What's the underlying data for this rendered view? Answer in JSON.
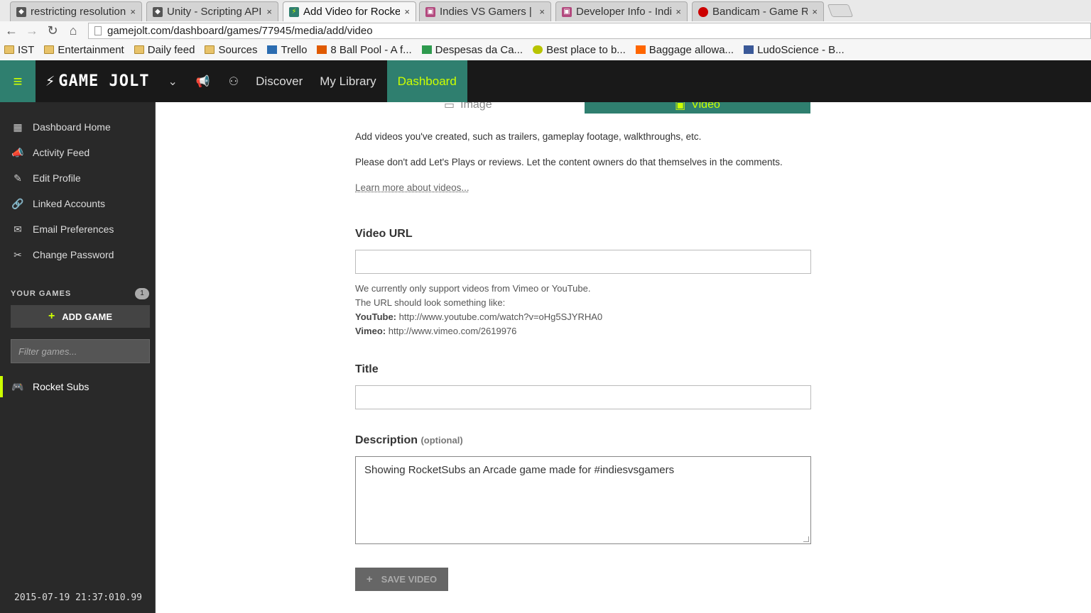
{
  "browser": {
    "tabs": [
      {
        "title": "restricting resolution",
        "favicon": "unity-icon"
      },
      {
        "title": "Unity - Scripting API:",
        "favicon": "unity-icon"
      },
      {
        "title": "Add Video for Rocke",
        "favicon": "gamejolt-icon"
      },
      {
        "title": "Indies VS Gamers | G",
        "favicon": "ivg-icon"
      },
      {
        "title": "Developer Info - Indi",
        "favicon": "ivg-icon"
      },
      {
        "title": "Bandicam - Game Re",
        "favicon": "bandicam-icon"
      }
    ],
    "close_glyph": "×",
    "url": "gamejolt.com/dashboard/games/77945/media/add/video",
    "bookmarks": [
      {
        "label": "IST",
        "icon": "folder-icon"
      },
      {
        "label": "Entertainment",
        "icon": "folder-icon"
      },
      {
        "label": "Daily feed",
        "icon": "folder-icon"
      },
      {
        "label": "Sources",
        "icon": "folder-icon"
      },
      {
        "label": "Trello",
        "icon": "trello-icon"
      },
      {
        "label": "8 Ball Pool - A f...",
        "icon": "play-icon"
      },
      {
        "label": "Despesas da Ca...",
        "icon": "sheets-icon"
      },
      {
        "label": "Best place to b...",
        "icon": "smiley-icon"
      },
      {
        "label": "Baggage allowa...",
        "icon": "easyjet-icon"
      },
      {
        "label": "LudoScience - B...",
        "icon": "facebook-icon"
      }
    ]
  },
  "header": {
    "logo": "GAME JOLT",
    "nav": {
      "discover": "Discover",
      "library": "My Library",
      "dashboard": "Dashboard"
    }
  },
  "sidebar": {
    "items": [
      {
        "label": "Dashboard Home",
        "icon": "dashboard-icon",
        "glyph": "▦"
      },
      {
        "label": "Activity Feed",
        "icon": "megaphone-icon",
        "glyph": "📣"
      },
      {
        "label": "Edit Profile",
        "icon": "pencil-icon",
        "glyph": "✎"
      },
      {
        "label": "Linked Accounts",
        "icon": "link-icon",
        "glyph": "🔗"
      },
      {
        "label": "Email Preferences",
        "icon": "envelope-icon",
        "glyph": "✉"
      },
      {
        "label": "Change Password",
        "icon": "tools-icon",
        "glyph": "✂"
      }
    ],
    "your_games_label": "YOUR GAMES",
    "games_count": "1",
    "add_game_label": "ADD GAME",
    "filter_placeholder": "Filter games...",
    "games": [
      {
        "label": "Rocket Subs",
        "icon": "gamepad-icon"
      }
    ],
    "timestamp": "2015-07-19 21:37:010.99"
  },
  "main": {
    "media_tabs": {
      "image": "Image",
      "video": "Video"
    },
    "intro1": "Add videos you've created, such as trailers, gameplay footage, walkthroughs, etc.",
    "intro2": "Please don't add Let's Plays or reviews. Let the content owners do that themselves in the comments.",
    "learn_more": "Learn more about videos...",
    "video_url_label": "Video URL",
    "video_url_value": "",
    "help1": "We currently only support videos from Vimeo or YouTube.",
    "help2": "The URL should look something like:",
    "youtube_label": "YouTube:",
    "youtube_example": "http://www.youtube.com/watch?v=oHg5SJYRHA0",
    "vimeo_label": "Vimeo:",
    "vimeo_example": "http://www.vimeo.com/2619976",
    "title_label": "Title",
    "title_value": "",
    "description_label": "Description",
    "optional_label": "(optional)",
    "description_value": "Showing RocketSubs an Arcade game made for #indiesvsgamers",
    "save_label": "SAVE VIDEO"
  }
}
